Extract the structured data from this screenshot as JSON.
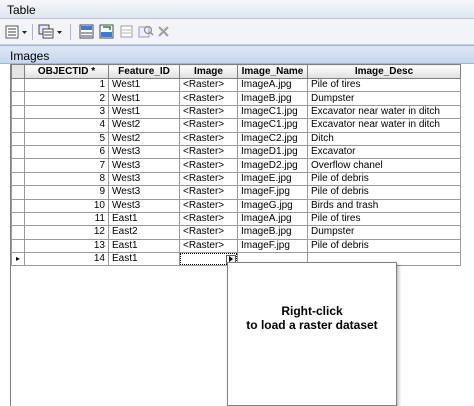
{
  "window": {
    "title": "Table"
  },
  "section": {
    "title": "Images"
  },
  "toolbar": {
    "buttons": [
      {
        "icon": "table-options-icon",
        "has_dropdown": true
      },
      {
        "icon": "related-tables-icon",
        "has_dropdown": true
      },
      {
        "icon": "select-by-attributes-icon",
        "has_dropdown": false
      },
      {
        "icon": "switch-selection-icon",
        "has_dropdown": false
      },
      {
        "icon": "clear-selection-icon",
        "has_dropdown": false
      },
      {
        "icon": "zoom-to-selected-icon",
        "has_dropdown": false
      },
      {
        "icon": "delete-selected-icon",
        "has_dropdown": false
      }
    ]
  },
  "grid": {
    "columns": [
      "OBJECTID *",
      "Feature_ID",
      "Image",
      "Image_Name",
      "Image_Desc"
    ],
    "rows": [
      {
        "objectid": "1",
        "feature_id": "West1",
        "image": "<Raster>",
        "image_name": "ImageA.jpg",
        "image_desc": "Pile of tires"
      },
      {
        "objectid": "2",
        "feature_id": "West1",
        "image": "<Raster>",
        "image_name": "ImageB.jpg",
        "image_desc": "Dumpster"
      },
      {
        "objectid": "3",
        "feature_id": "West1",
        "image": "<Raster>",
        "image_name": "ImageC1.jpg",
        "image_desc": "Excavator near water in ditch"
      },
      {
        "objectid": "4",
        "feature_id": "West2",
        "image": "<Raster>",
        "image_name": "ImageC1.jpg",
        "image_desc": "Excavator near water in ditch"
      },
      {
        "objectid": "5",
        "feature_id": "West2",
        "image": "<Raster>",
        "image_name": "ImageC2.jpg",
        "image_desc": "Ditch"
      },
      {
        "objectid": "6",
        "feature_id": "West3",
        "image": "<Raster>",
        "image_name": "ImageD1.jpg",
        "image_desc": "Excavator"
      },
      {
        "objectid": "7",
        "feature_id": "West3",
        "image": "<Raster>",
        "image_name": "ImageD2.jpg",
        "image_desc": "Overflow chanel"
      },
      {
        "objectid": "8",
        "feature_id": "West3",
        "image": "<Raster>",
        "image_name": "ImageE.jpg",
        "image_desc": "Pile of debris"
      },
      {
        "objectid": "9",
        "feature_id": "West3",
        "image": "<Raster>",
        "image_name": "ImageF.jpg",
        "image_desc": "Pile of debris"
      },
      {
        "objectid": "10",
        "feature_id": "West3",
        "image": "<Raster>",
        "image_name": "ImageG.jpg",
        "image_desc": "Birds and trash"
      },
      {
        "objectid": "11",
        "feature_id": "East1",
        "image": "<Raster>",
        "image_name": "ImageA.jpg",
        "image_desc": "Pile of tires"
      },
      {
        "objectid": "12",
        "feature_id": "East2",
        "image": "<Raster>",
        "image_name": "ImageB.jpg",
        "image_desc": "Dumpster"
      },
      {
        "objectid": "13",
        "feature_id": "East1",
        "image": "<Raster>",
        "image_name": "ImageF.jpg",
        "image_desc": "Pile of debris"
      },
      {
        "objectid": "14",
        "feature_id": "East1",
        "image": "",
        "image_name": "",
        "image_desc": ""
      }
    ],
    "current_row_marker": "▸"
  },
  "tooltip": {
    "line1": "Right-click",
    "line2": "to load a raster dataset"
  }
}
